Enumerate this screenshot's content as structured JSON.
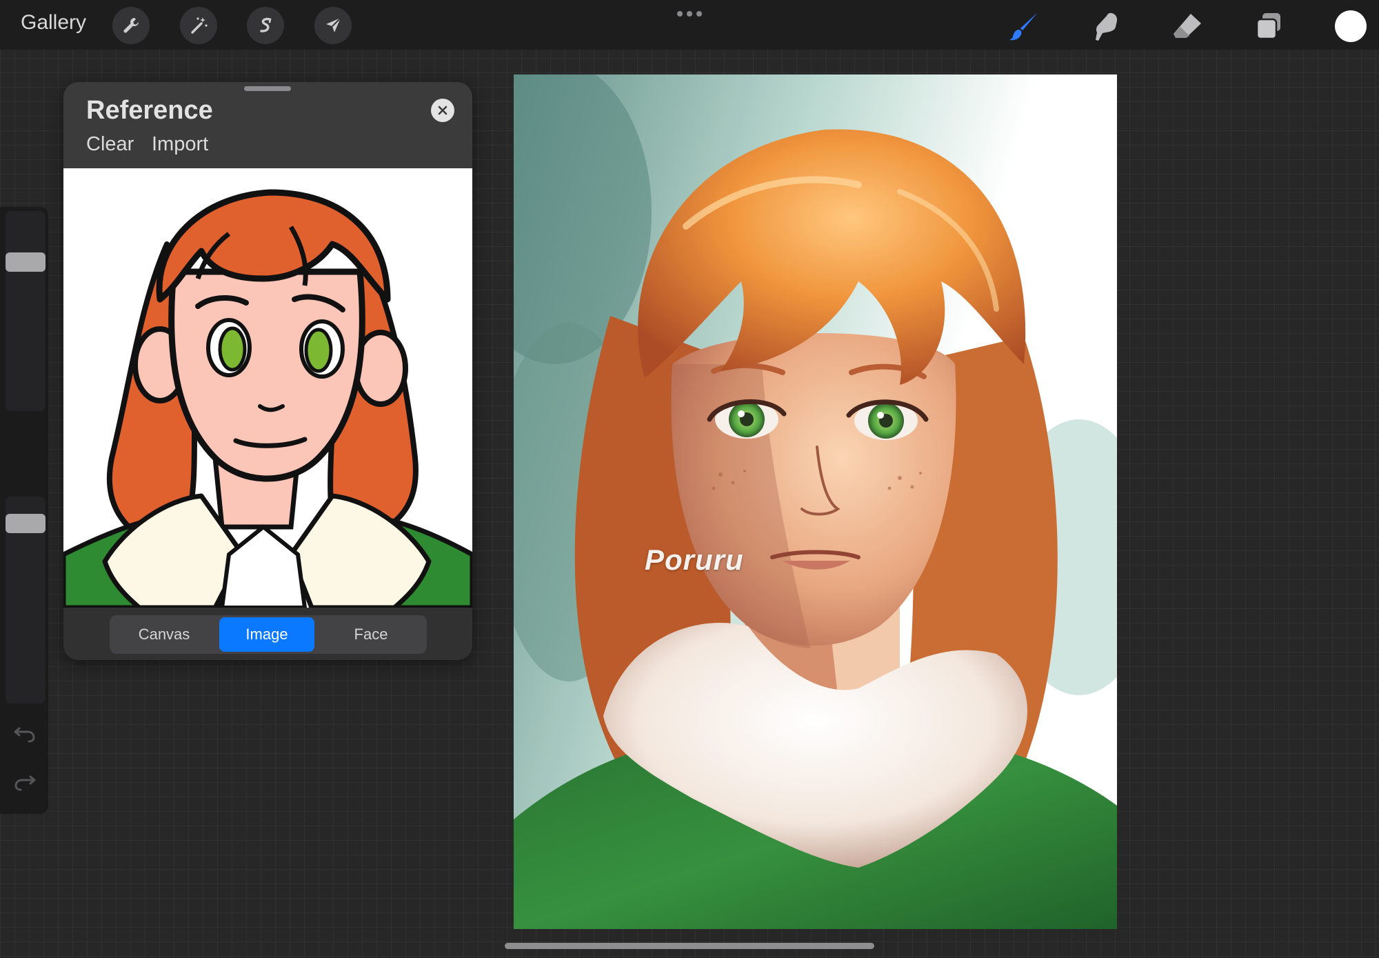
{
  "toolbar": {
    "gallery_label": "Gallery",
    "left_tools": [
      {
        "name": "actions",
        "icon": "wrench-icon"
      },
      {
        "name": "adjustments",
        "icon": "magic-wand-icon"
      },
      {
        "name": "selection",
        "icon": "selection-s-icon"
      },
      {
        "name": "transform",
        "icon": "arrow-cursor-icon"
      }
    ],
    "right_tools": [
      {
        "name": "brush",
        "icon": "brush-icon",
        "active": true
      },
      {
        "name": "smudge",
        "icon": "smudge-finger-icon"
      },
      {
        "name": "eraser",
        "icon": "eraser-icon"
      },
      {
        "name": "layers",
        "icon": "layers-icon"
      }
    ],
    "current_color": "#ffffff",
    "active_color": "#2f7bff"
  },
  "sidebar": {
    "size_slider_level": 0.22,
    "opacity_slider_level": 0.08
  },
  "reference": {
    "title": "Reference",
    "clear_label": "Clear",
    "import_label": "Import",
    "modes": [
      {
        "label": "Canvas",
        "active": false
      },
      {
        "label": "Image",
        "active": true
      },
      {
        "label": "Face",
        "active": false
      }
    ]
  },
  "canvas": {
    "watermark": "Poruru"
  }
}
